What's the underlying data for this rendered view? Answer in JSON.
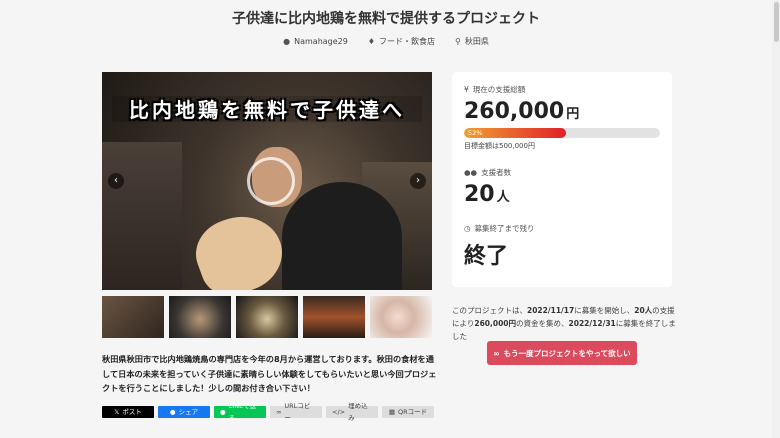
{
  "project": {
    "title": "子供達に比内地鶏を無料で提供するプロジェクト",
    "author": "Namahage29",
    "category": "フード・飲食店",
    "location": "秋田県"
  },
  "hero": {
    "banner_text": "比内地鶏を無料で子供達へ",
    "prev_icon": "‹",
    "next_icon": "›"
  },
  "description": "秋田県秋田市で比内地鶏焼鳥の専門店を今年の8月から運営しております。秋田の食材を通して日本の未来を担っていく子供達に素晴らしい体験をしてもらいたいと思い今回プロジェクトを行うことにしました！少しの間お付き合い下さい！",
  "share": {
    "x": "ポスト",
    "facebook": "シェア",
    "line": "LINEで送る",
    "url": "URLコピー",
    "embed": "埋め込み",
    "qr": "QRコード"
  },
  "stats": {
    "total_label": "現在の支援総額",
    "total_value": "260,000",
    "total_unit": "円",
    "progress_percent": 52,
    "progress_label": "52%",
    "goal_text": "目標金額は500,000円",
    "supporters_label": "支援者数",
    "supporters_value": "20",
    "supporters_unit": "人",
    "remaining_label": "募集終了まで残り",
    "remaining_value": "終了"
  },
  "note": {
    "p1": "このプロジェクトは、",
    "start_date": "2022/11/17",
    "p2": "に募集を開始し、",
    "supporters": "20人",
    "p3": "の支援により",
    "amount": "260,000円",
    "p4": "の資金を集め、",
    "end_date": "2022/12/31",
    "p5": "に募集を終了しました"
  },
  "cta": {
    "label": "もう一度プロジェクトをやって欲しい"
  }
}
